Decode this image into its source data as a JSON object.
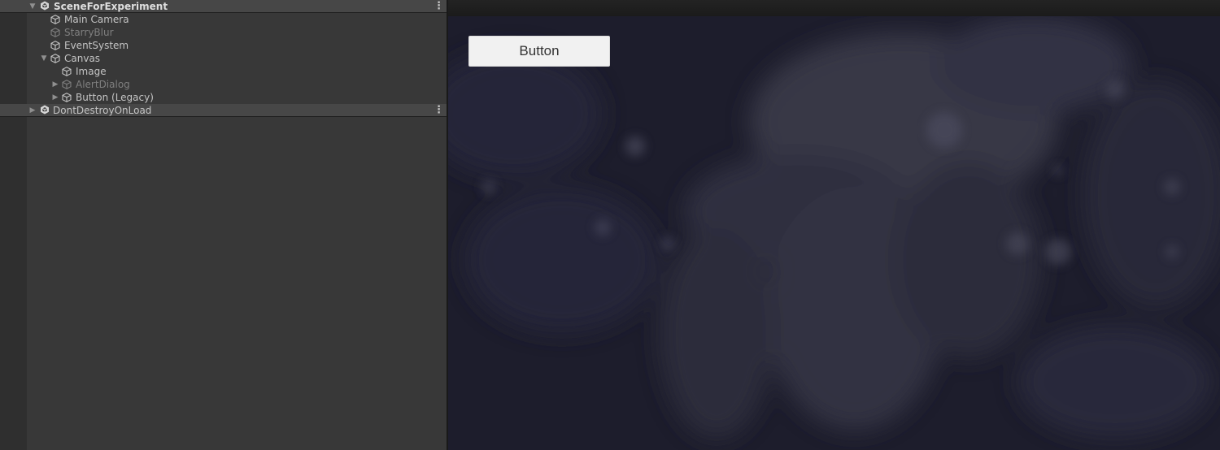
{
  "hierarchy": {
    "scene": {
      "name": "SceneForExperiment",
      "icon": "unity-scene-icon",
      "menu_icon": "more-options-icon"
    },
    "objects": [
      {
        "name": "Main Camera",
        "icon": "gameobject-cube-icon",
        "active": true
      },
      {
        "name": "StarryBlur",
        "icon": "gameobject-cube-icon",
        "active": false
      },
      {
        "name": "EventSystem",
        "icon": "gameobject-cube-icon",
        "active": true
      },
      {
        "name": "Canvas",
        "icon": "gameobject-cube-icon",
        "active": true,
        "expanded": true
      },
      {
        "name": "Image",
        "icon": "gameobject-cube-icon",
        "active": true
      },
      {
        "name": "AlertDialog",
        "icon": "gameobject-cube-icon",
        "active": false,
        "expanded": false
      },
      {
        "name": "Button (Legacy)",
        "icon": "gameobject-cube-icon",
        "active": true,
        "expanded": false
      }
    ],
    "dont_destroy": {
      "name": "DontDestroyOnLoad",
      "icon": "unity-scene-icon",
      "menu_icon": "more-options-icon",
      "expanded": false
    }
  },
  "game": {
    "button_label": "Button",
    "background": "blurred-starry-anime-artwork"
  },
  "colors": {
    "panel_bg": "#383838",
    "scene_header_bg": "#474747",
    "text": "#c4c4c4",
    "inactive_text": "#7f7f7f",
    "game_bg": "#1c1c2a",
    "button_bg": "#f1f1f1"
  }
}
